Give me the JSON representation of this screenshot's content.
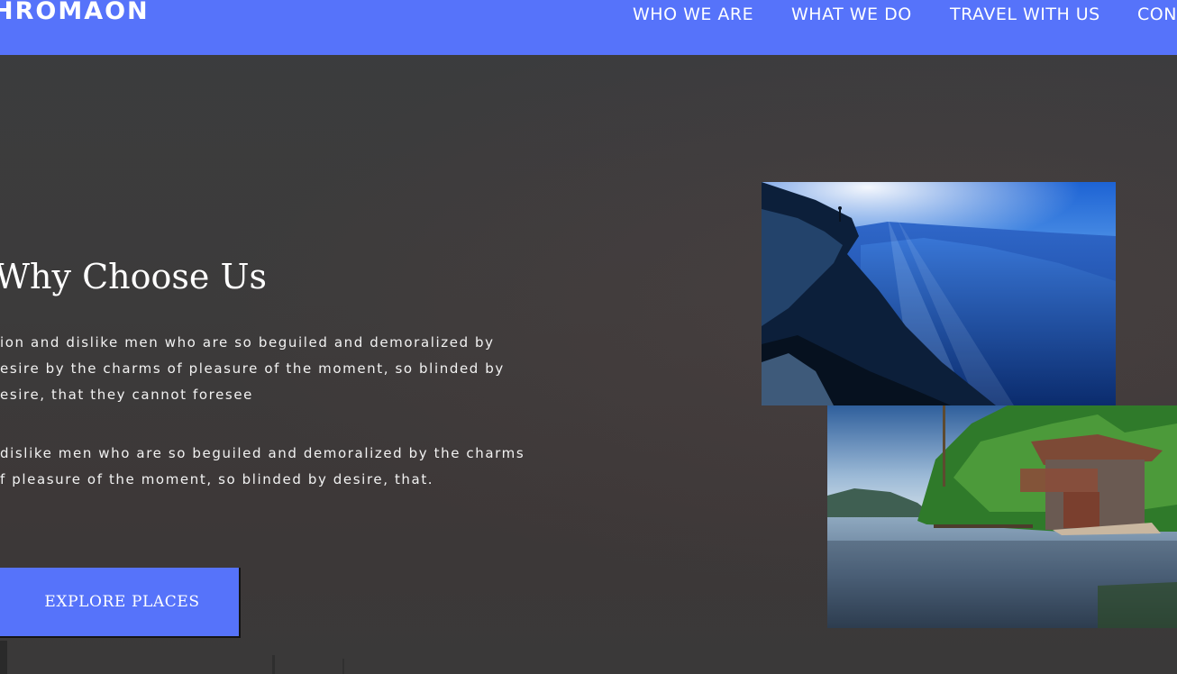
{
  "navbar": {
    "brand": "HROMAON",
    "links": [
      {
        "label": "WHO WE ARE"
      },
      {
        "label": "WHAT WE DO"
      },
      {
        "label": "TRAVEL WITH US"
      },
      {
        "label": "CON"
      }
    ],
    "background_color": "#5673fa"
  },
  "hero": {
    "heading": "Why Choose Us",
    "paragraph_1": {
      "lines": [
        "ion and dislike men who are so beguiled and demoralized by",
        "esire by the charms of pleasure of the moment, so blinded by",
        "esire, that they cannot foresee"
      ]
    },
    "paragraph_2": {
      "lines": [
        "dislike men who are so beguiled and demoralized by the charms",
        "f pleasure of the moment, so blinded by desire, that."
      ]
    },
    "cta_label": "EXPLORE PLACES",
    "cta_color": "#5673fa"
  },
  "images": [
    {
      "name": "mountain-valley-photo"
    },
    {
      "name": "lake-boathouse-photo"
    }
  ]
}
